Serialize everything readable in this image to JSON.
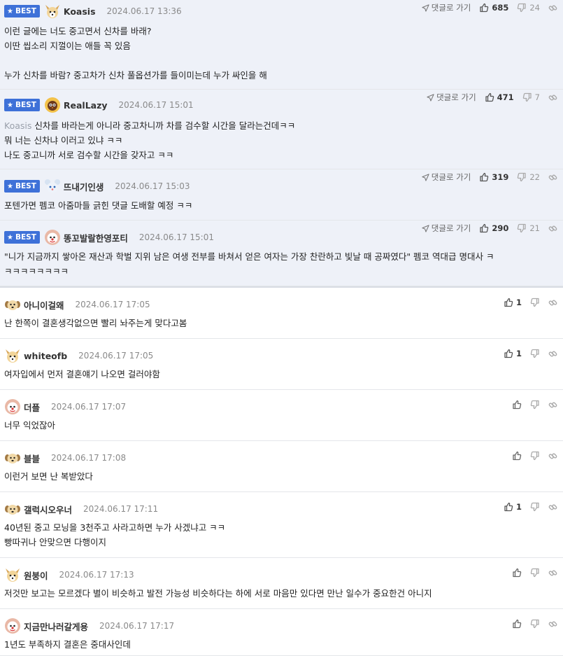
{
  "best_label": "BEST",
  "reply_label": "댓글로 가기",
  "comments": [
    {
      "best": true,
      "avatar": "fox",
      "nick": "Koasis",
      "date": "2024.06.17 13:36",
      "reply_link": true,
      "likes": "685",
      "dislikes": "24",
      "lines": [
        "이런 글에는 너도 중고면서 신차를 바래?",
        "이딴 씹소리 지껄이는 애들 꼭 있음",
        "",
        "누가 신차를 바람? 중고차가 신차 풀옵션가를 들이미는데 누가 싸인을 해"
      ]
    },
    {
      "best": true,
      "avatar": "bird",
      "nick": "RealLazy",
      "date": "2024.06.17 15:01",
      "reply_link": true,
      "likes": "471",
      "dislikes": "7",
      "mention": "Koasis",
      "lines": [
        "신차를 바라는게 아니라 중고차니까 차를 검수할 시간을 달라는건데ㅋㅋ",
        "뭐 너는 신차냐 이러고 있냐 ㅋㅋ",
        "나도 중고니까 서로 검수할 시간을 갖자고 ㅋㅋ"
      ]
    },
    {
      "best": true,
      "avatar": "mouse",
      "nick": "뜨내기인생",
      "date": "2024.06.17 15:03",
      "reply_link": true,
      "likes": "319",
      "dislikes": "22",
      "lines": [
        "포텐가면 펨코 아줌마들 긁힌 댓글 도배할 예정 ㅋㅋ"
      ]
    },
    {
      "best": true,
      "avatar": "clown",
      "nick": "똥꼬발랄한영포티",
      "date": "2024.06.17 15:01",
      "reply_link": true,
      "likes": "290",
      "dislikes": "21",
      "lines": [
        "\"니가 지금까지 쌓아온 재산과 학벌 지위 남은 여생 전부를 바쳐서 얻은 여자는 가장 찬란하고 빛날 때 공짜였다\" 펨코 역대급 명대사 ㅋ",
        "ㅋㅋㅋㅋㅋㅋㅋㅋ"
      ]
    },
    {
      "best": false,
      "avatar": "dog",
      "nick": "아니이걸왜",
      "date": "2024.06.17 17:05",
      "reply_link": false,
      "likes": "1",
      "dislikes": "",
      "lines": [
        "난 한쪽이 결혼생각없으면 빨리 놔주는게 맞다고봄"
      ]
    },
    {
      "best": false,
      "avatar": "fox",
      "nick": "whiteofb",
      "date": "2024.06.17 17:05",
      "reply_link": false,
      "likes": "1",
      "dislikes": "",
      "lines": [
        "여자입에서 먼저 결혼얘기 나오면 걸러야함"
      ]
    },
    {
      "best": false,
      "avatar": "clown",
      "nick": "더플",
      "date": "2024.06.17 17:07",
      "reply_link": false,
      "likes": "",
      "dislikes": "",
      "lines": [
        "너무 익었잖아"
      ]
    },
    {
      "best": false,
      "avatar": "dog",
      "nick": "블블",
      "date": "2024.06.17 17:08",
      "reply_link": false,
      "likes": "",
      "dislikes": "",
      "lines": [
        "이런거 보면 난 복받았다"
      ]
    },
    {
      "best": false,
      "avatar": "dog",
      "nick": "갤럭시오우너",
      "date": "2024.06.17 17:11",
      "reply_link": false,
      "likes": "1",
      "dislikes": "",
      "lines": [
        "40년된 중고 모닝을 3천주고 사라고하면 누가 사겠냐고 ㅋㅋ",
        "빵따귀나 안맞으면 다행이지"
      ]
    },
    {
      "best": false,
      "avatar": "fox",
      "nick": "원붕이",
      "date": "2024.06.17 17:13",
      "reply_link": false,
      "likes": "",
      "dislikes": "",
      "lines": [
        "저것만 보고는 모르겠다 별이 비슷하고 발전 가능성 비슷하다는 하에 서로 마음만 있다면 만난 일수가 중요한건 아니지"
      ]
    },
    {
      "best": false,
      "avatar": "clown",
      "nick": "지금만나러갈게용",
      "date": "2024.06.17 17:17",
      "reply_link": false,
      "likes": "",
      "dislikes": "",
      "lines": [
        "1년도 부족하지 결혼은 중대사인데"
      ]
    }
  ]
}
